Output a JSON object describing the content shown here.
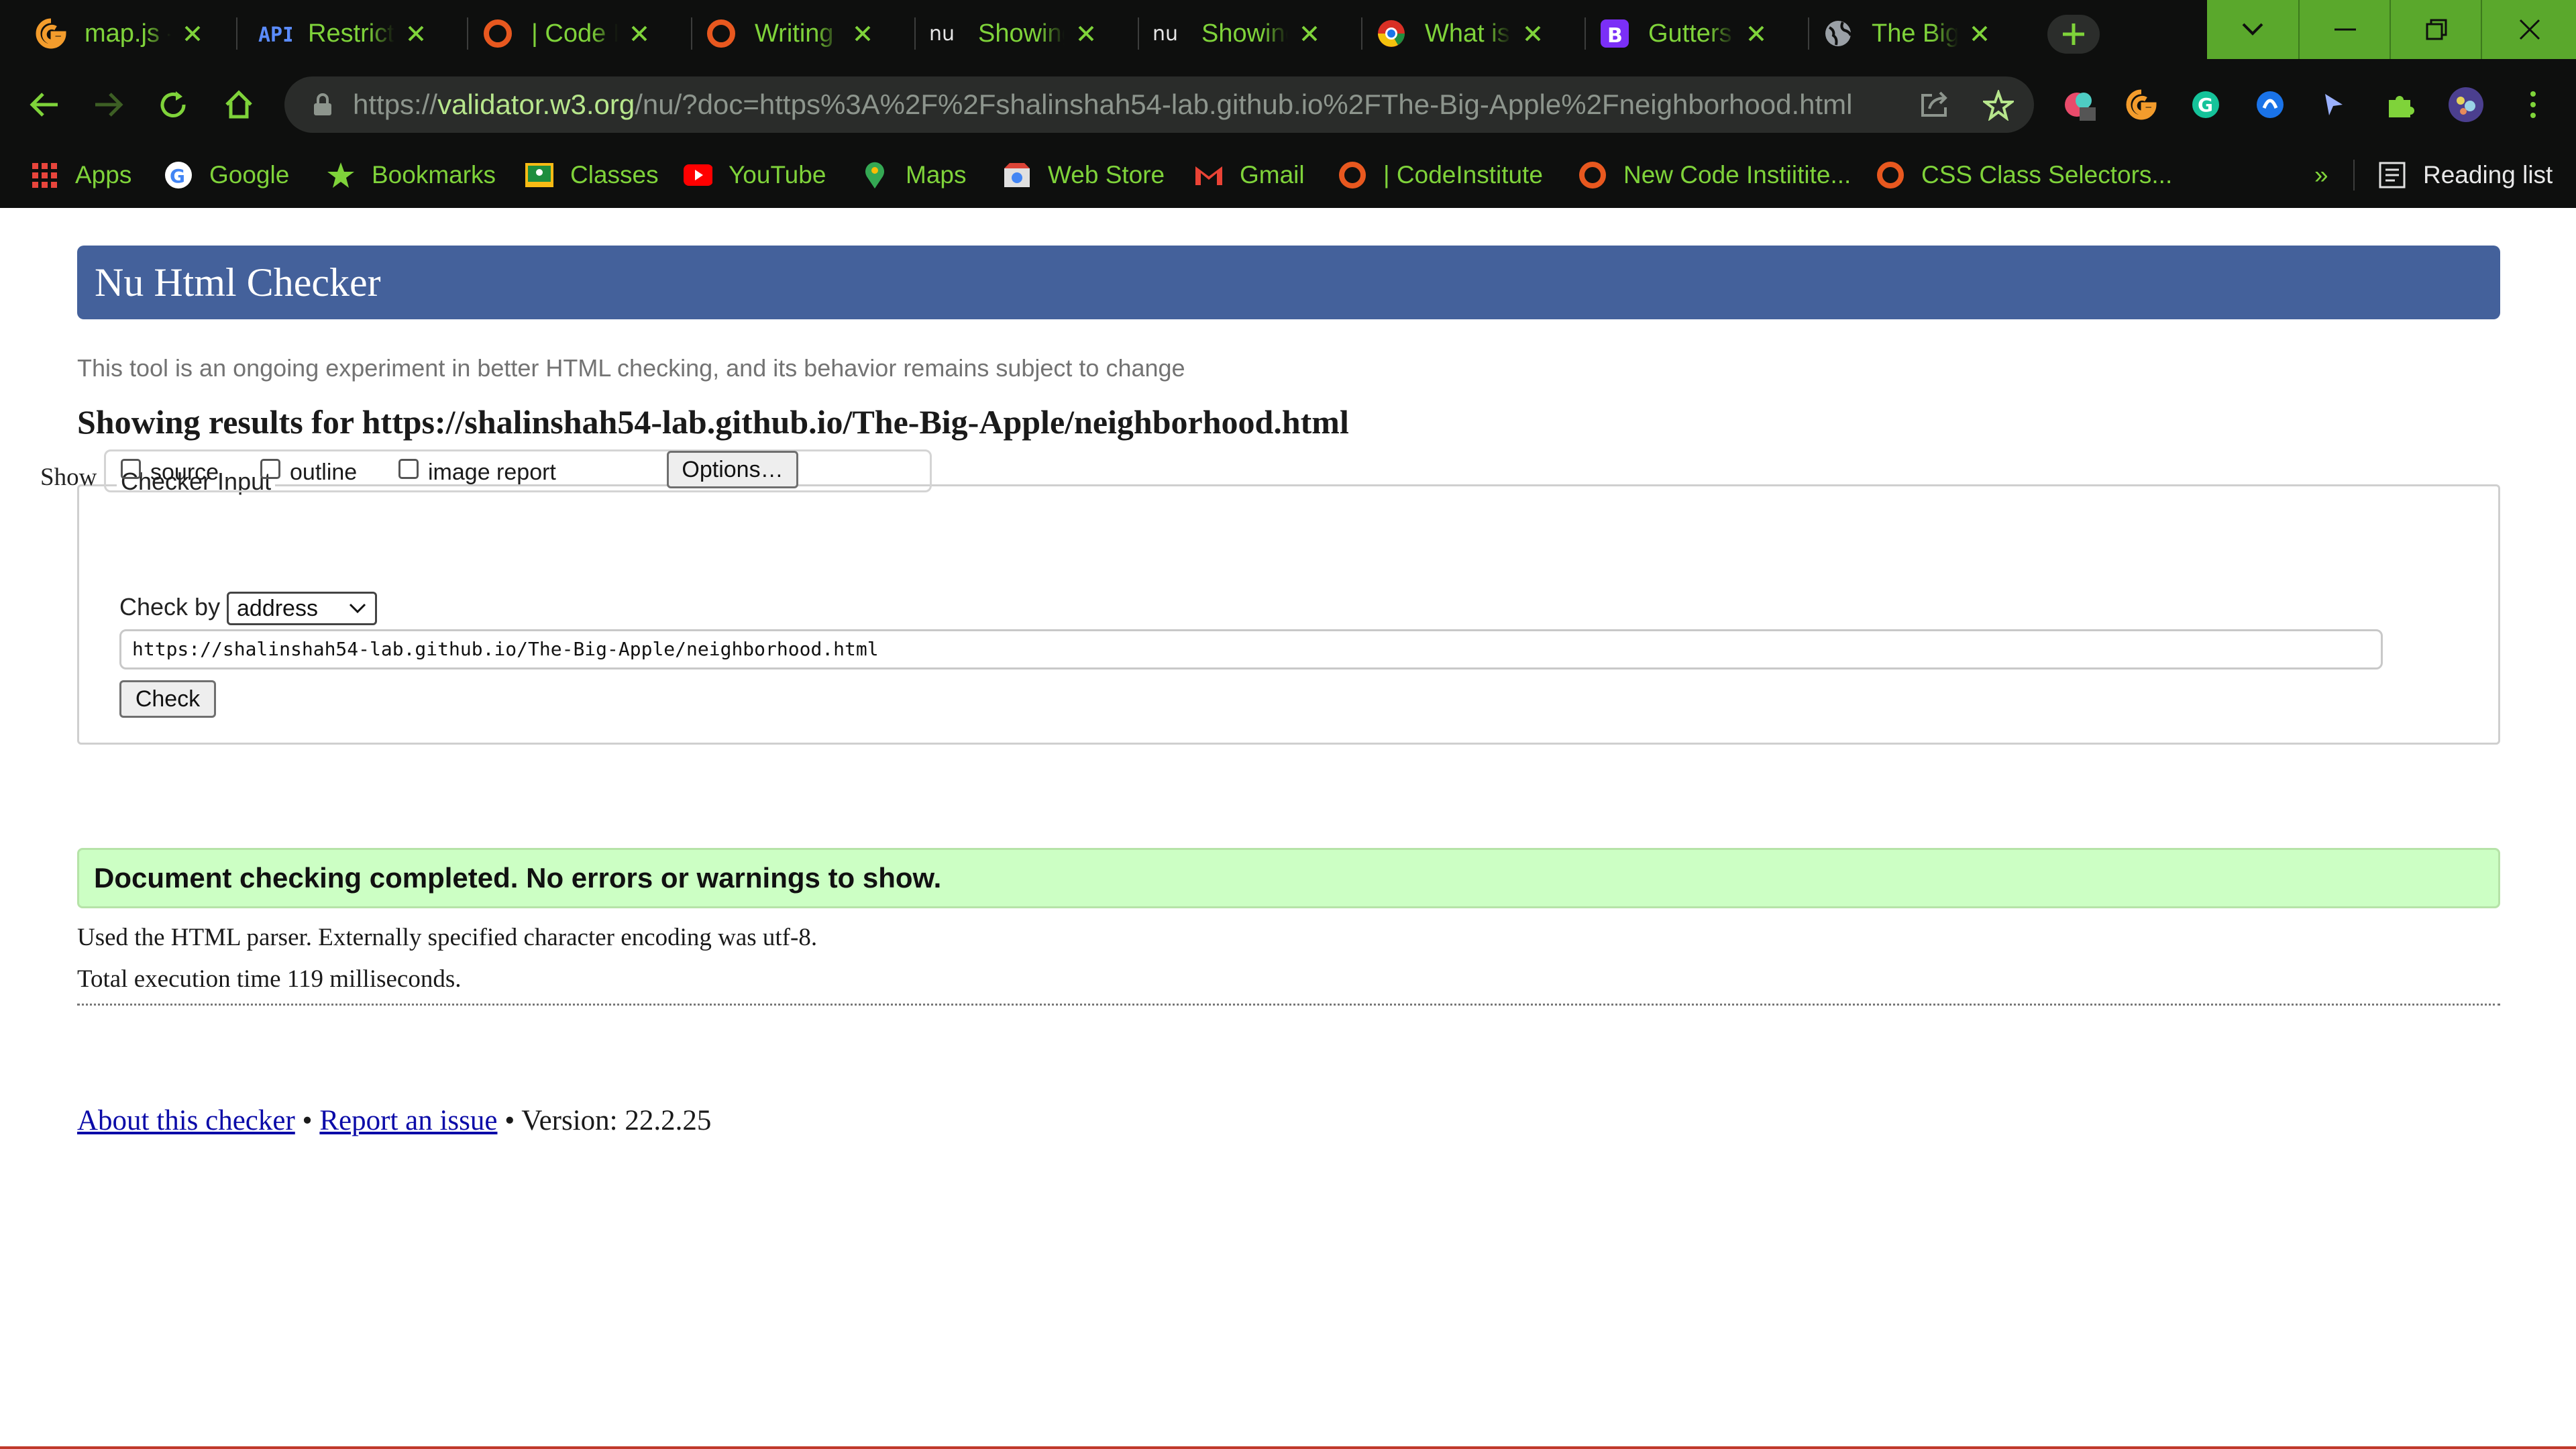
{
  "browser": {
    "tabs": [
      {
        "title": "map.js -",
        "icon": "g-logo-icon"
      },
      {
        "title": "Restrict a",
        "icon": "api-icon"
      },
      {
        "title": "| Code Ir",
        "icon": "codeinstitute-icon"
      },
      {
        "title": "Writing y",
        "icon": "codeinstitute-icon"
      },
      {
        "title": "Showing",
        "icon": "nu-icon"
      },
      {
        "title": "Showing",
        "icon": "nu-icon"
      },
      {
        "title": "What is t",
        "icon": "chrome-icon"
      },
      {
        "title": "Gutters",
        "icon": "bootstrap-icon"
      },
      {
        "title": "The Big A",
        "icon": "globe-icon"
      }
    ],
    "address": {
      "scheme": "https://",
      "host": "validator.w3.org",
      "path": "/nu/?doc=https%3A%2F%2Fshalinshah54-lab.github.io%2FThe-Big-Apple%2Fneighborhood.html"
    },
    "bookmarks": [
      {
        "label": "Apps",
        "icon": "apps-grid-icon"
      },
      {
        "label": "Google",
        "icon": "google-icon"
      },
      {
        "label": "Bookmarks",
        "icon": "star-icon"
      },
      {
        "label": "Classes",
        "icon": "classroom-icon"
      },
      {
        "label": "YouTube",
        "icon": "youtube-icon"
      },
      {
        "label": "Maps",
        "icon": "maps-pin-icon"
      },
      {
        "label": "Web Store",
        "icon": "webstore-icon"
      },
      {
        "label": "Gmail",
        "icon": "gmail-icon"
      },
      {
        "label": "| CodeInstitute",
        "icon": "codeinstitute-icon"
      },
      {
        "label": "New Code Instiitite...",
        "icon": "codeinstitute-icon"
      },
      {
        "label": "CSS Class Selectors...",
        "icon": "codeinstitute-icon"
      }
    ],
    "bookmarks_overflow": "»",
    "reading_list": "Reading list"
  },
  "page": {
    "banner_title": "Nu Html Checker",
    "subtitle": "This tool is an ongoing experiment in better HTML checking, and its behavior remains subject to change",
    "results_heading": "Showing results for https://shalinshah54-lab.github.io/The-Big-Apple/neighborhood.html",
    "checker_input": {
      "legend": "Checker Input",
      "show_label": "Show",
      "checkboxes": [
        "source",
        "outline",
        "image report"
      ],
      "options_button": "Options…",
      "check_by_label": "Check by",
      "check_by_value": "address",
      "url_value": "https://shalinshah54-lab.github.io/The-Big-Apple/neighborhood.html",
      "check_button": "Check"
    },
    "success_message": "Document checking completed. No errors or warnings to show.",
    "parser_info": "Used the HTML parser. Externally specified character encoding was utf-8.",
    "execution_time": "Total execution time 119 milliseconds.",
    "footer": {
      "about_link": "About this checker",
      "bullet": "•",
      "report_link": "Report an issue",
      "version": "Version: 22.2.25"
    }
  },
  "colors": {
    "chrome_bg": "#0e0f0e",
    "chrome_text": "#7fd33a",
    "banner": "#44619b",
    "success_bg": "#ccffc4",
    "link": "#0b0ba8"
  }
}
